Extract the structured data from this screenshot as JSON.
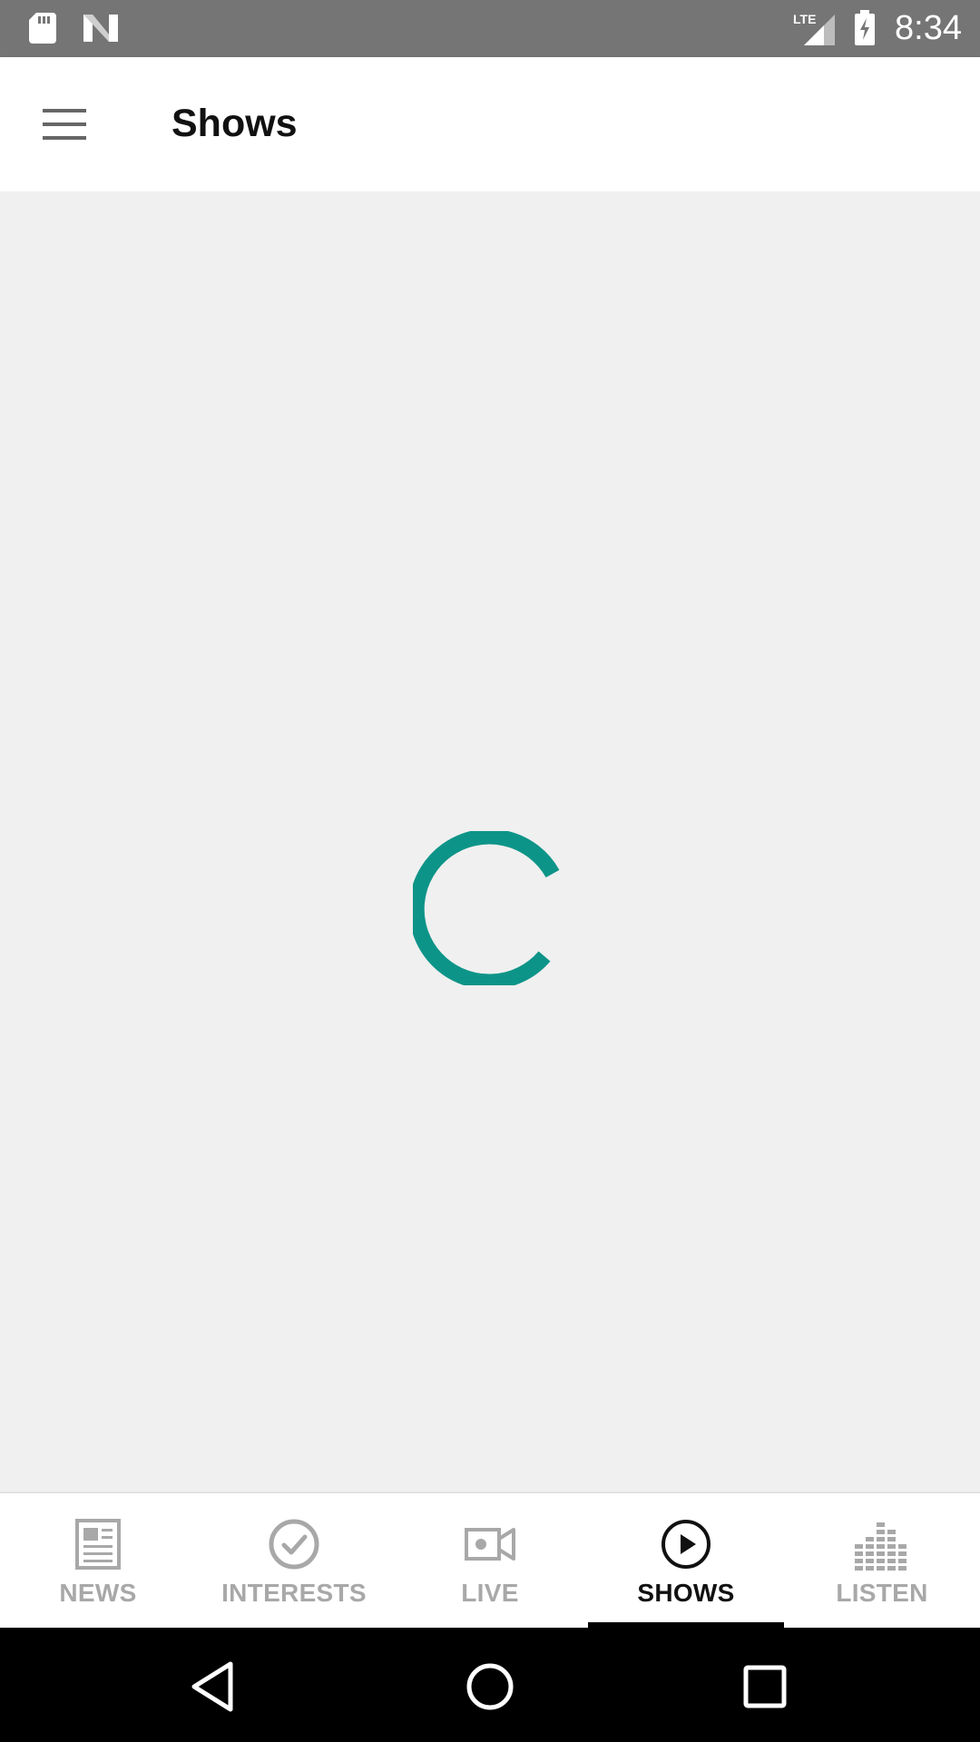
{
  "status_bar": {
    "network": "LTE",
    "time": "8:34",
    "icons": [
      "sd-card-icon",
      "n-logo-icon",
      "lte-signal-icon",
      "battery-charging-icon"
    ]
  },
  "app_bar": {
    "title": "Shows",
    "menu_icon": "hamburger-menu-icon"
  },
  "content": {
    "loading": true,
    "spinner_color": "#0d9488"
  },
  "bottom_nav": {
    "tabs": [
      {
        "label": "NEWS",
        "icon": "newspaper-icon",
        "active": false
      },
      {
        "label": "INTERESTS",
        "icon": "check-circle-icon",
        "active": false
      },
      {
        "label": "LIVE",
        "icon": "video-camera-icon",
        "active": false
      },
      {
        "label": "SHOWS",
        "icon": "play-circle-icon",
        "active": true
      },
      {
        "label": "LISTEN",
        "icon": "equalizer-icon",
        "active": false
      }
    ],
    "inactive_color": "#a8a8a8",
    "active_color": "#111111"
  },
  "system_nav": {
    "buttons": [
      "back-icon",
      "home-icon",
      "recents-icon"
    ]
  }
}
